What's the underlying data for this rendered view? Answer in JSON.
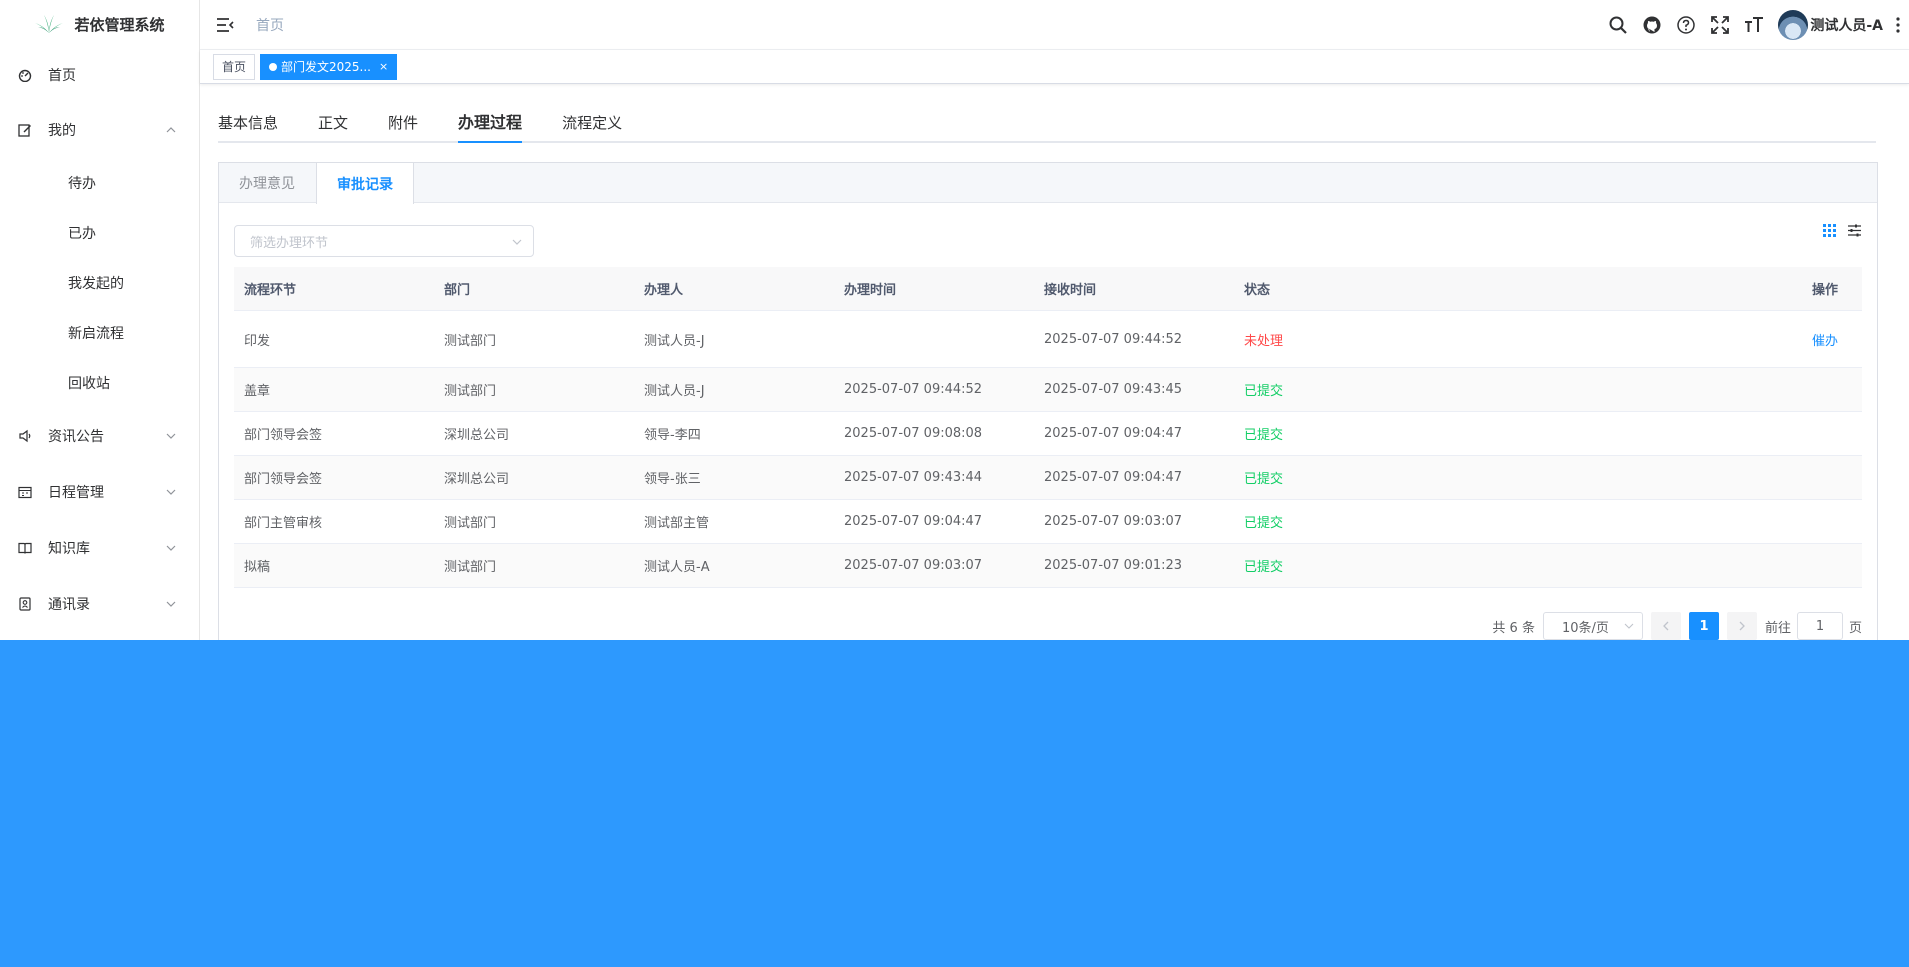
{
  "app": {
    "title": "若依管理系统"
  },
  "sidebar": {
    "items": [
      {
        "label": "首页",
        "icon": "dashboard-icon"
      },
      {
        "label": "我的",
        "icon": "edit-icon",
        "expanded": true,
        "children": [
          "待办",
          "已办",
          "我发起的",
          "新启流程",
          "回收站"
        ]
      },
      {
        "label": "资讯公告",
        "icon": "speaker-icon"
      },
      {
        "label": "日程管理",
        "icon": "calendar-icon"
      },
      {
        "label": "知识库",
        "icon": "book-icon"
      },
      {
        "label": "通讯录",
        "icon": "contact-icon"
      }
    ]
  },
  "navbar": {
    "breadcrumb": "首页",
    "username": "测试人员-A",
    "icons": [
      "search-icon",
      "github-icon",
      "help-icon",
      "fullscreen-icon",
      "font-size-icon"
    ]
  },
  "tags": [
    {
      "label": "首页",
      "active": false
    },
    {
      "label": "部门发文2025...",
      "active": true,
      "close": "×"
    }
  ],
  "main": {
    "tabs": [
      "基本信息",
      "正文",
      "附件",
      "办理过程",
      "流程定义"
    ],
    "active_tab": "办理过程",
    "card_tabs": [
      "办理意见",
      "审批记录"
    ],
    "active_card_tab": "审批记录",
    "filter_placeholder": "筛选办理环节"
  },
  "table": {
    "headers": [
      "流程环节",
      "部门",
      "办理人",
      "办理时间",
      "接收时间",
      "状态",
      "操作"
    ],
    "rows": [
      {
        "step": "印发",
        "dept": "测试部门",
        "handler": "测试人员-J",
        "handled": "",
        "received": "2025-07-07 09:44:52",
        "status": "未处理",
        "action": "催办"
      },
      {
        "step": "盖章",
        "dept": "测试部门",
        "handler": "测试人员-J",
        "handled": "2025-07-07 09:44:52",
        "received": "2025-07-07 09:43:45",
        "status": "已提交",
        "action": ""
      },
      {
        "step": "部门领导会签",
        "dept": "深圳总公司",
        "handler": "领导-李四",
        "handled": "2025-07-07 09:08:08",
        "received": "2025-07-07 09:04:47",
        "status": "已提交",
        "action": ""
      },
      {
        "step": "部门领导会签",
        "dept": "深圳总公司",
        "handler": "领导-张三",
        "handled": "2025-07-07 09:43:44",
        "received": "2025-07-07 09:04:47",
        "status": "已提交",
        "action": ""
      },
      {
        "step": "部门主管审核",
        "dept": "测试部门",
        "handler": "测试部主管",
        "handled": "2025-07-07 09:04:47",
        "received": "2025-07-07 09:03:07",
        "status": "已提交",
        "action": ""
      },
      {
        "step": "拟稿",
        "dept": "测试部门",
        "handler": "测试人员-A",
        "handled": "2025-07-07 09:03:07",
        "received": "2025-07-07 09:01:23",
        "status": "已提交",
        "action": ""
      }
    ]
  },
  "pagination": {
    "total": "共 6 条",
    "page_size": "10条/页",
    "current": "1",
    "goto_label": "前往",
    "goto_value": "1",
    "page_unit": "页"
  },
  "colors": {
    "accent": "#1890ff",
    "overlay": "#2d99fe",
    "status_pending": "#ff4949",
    "status_done": "#13ce66"
  }
}
